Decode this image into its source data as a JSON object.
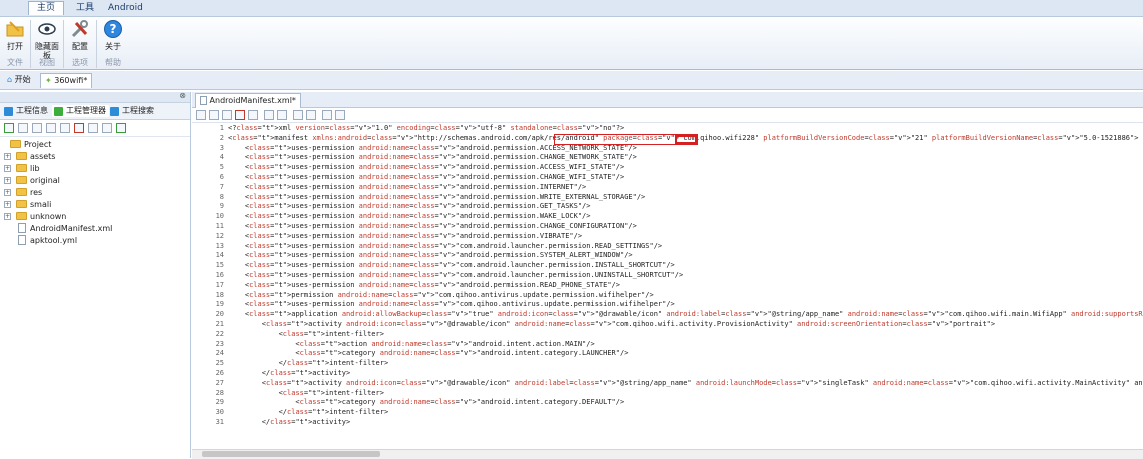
{
  "ribbon": {
    "tabs": [
      "主页",
      "工具",
      "Android"
    ],
    "buttons": [
      {
        "label": "打开",
        "icon": "open-folder-icon"
      },
      {
        "label": "隐藏面板",
        "icon": "eye-icon"
      },
      {
        "label": "配置",
        "icon": "tools-icon"
      },
      {
        "label": "关于",
        "icon": "help-icon"
      }
    ],
    "groups": [
      "文件",
      "视图",
      "选项",
      "帮助"
    ]
  },
  "doc_tabs": {
    "home": "开始",
    "project": "360wifi*"
  },
  "left": {
    "tabs": [
      "工程信息",
      "工程管理器",
      "工程搜索"
    ],
    "tree": {
      "root": "Project",
      "children": [
        "assets",
        "lib",
        "original",
        "res",
        "smali",
        "unknown",
        "AndroidManifest.xml",
        "apktool.yml"
      ]
    }
  },
  "editor": {
    "tab": "AndroidManifest.xml*",
    "lines": [
      "<?xml version=\"1.0\" encoding=\"utf-8\" standalone=\"no\"?>",
      "<manifest xmlns:android=\"http://schemas.android.com/apk/res/android\" package=\"com.qihoo.wifi228\" platformBuildVersionCode=\"21\" platformBuildVersionName=\"5.0-1521886\">",
      "    <uses-permission android:name=\"android.permission.ACCESS_NETWORK_STATE\"/>",
      "    <uses-permission android:name=\"android.permission.CHANGE_NETWORK_STATE\"/>",
      "    <uses-permission android:name=\"android.permission.ACCESS_WIFI_STATE\"/>",
      "    <uses-permission android:name=\"android.permission.CHANGE_WIFI_STATE\"/>",
      "    <uses-permission android:name=\"android.permission.INTERNET\"/>",
      "    <uses-permission android:name=\"android.permission.WRITE_EXTERNAL_STORAGE\"/>",
      "    <uses-permission android:name=\"android.permission.GET_TASKS\"/>",
      "    <uses-permission android:name=\"android.permission.WAKE_LOCK\"/>",
      "    <uses-permission android:name=\"android.permission.CHANGE_CONFIGURATION\"/>",
      "    <uses-permission android:name=\"android.permission.VIBRATE\"/>",
      "    <uses-permission android:name=\"com.android.launcher.permission.READ_SETTINGS\"/>",
      "    <uses-permission android:name=\"android.permission.SYSTEM_ALERT_WINDOW\"/>",
      "    <uses-permission android:name=\"com.android.launcher.permission.INSTALL_SHORTCUT\"/>",
      "    <uses-permission android:name=\"com.android.launcher.permission.UNINSTALL_SHORTCUT\"/>",
      "    <uses-permission android:name=\"android.permission.READ_PHONE_STATE\"/>",
      "    <permission android:name=\"com.qihoo.antivirus.update.permission.wifihelper\"/>",
      "    <uses-permission android:name=\"com.qihoo.antivirus.update.permission.wifihelper\"/>",
      "    <application android:allowBackup=\"true\" android:icon=\"@drawable/icon\" android:label=\"@string/app_name\" android:name=\"com.qihoo.wifi.main.WifiApp\" android:supportsRtl=\"true\" android:th",
      "        <activity android:icon=\"@drawable/icon\" android:name=\"com.qihoo.wifi.activity.ProvisionActivity\" android:screenOrientation=\"portrait\">",
      "            <intent-filter>",
      "                <action android:name=\"android.intent.action.MAIN\"/>",
      "                <category android:name=\"android.intent.category.LAUNCHER\"/>",
      "            </intent-filter>",
      "        </activity>",
      "        <activity android:icon=\"@drawable/icon\" android:label=\"@string/app_name\" android:launchMode=\"singleTask\" android:name=\"com.qihoo.wifi.activity.MainActivity\" android:screenOrientat",
      "            <intent-filter>",
      "                <category android:name=\"android.intent.category.DEFAULT\"/>",
      "            </intent-filter>",
      "        </activity>"
    ]
  },
  "colors": {
    "highlight_box": "#d42020",
    "tag": "#2a4fb0",
    "attr": "#c0392b",
    "value": "#1a1a8c"
  }
}
